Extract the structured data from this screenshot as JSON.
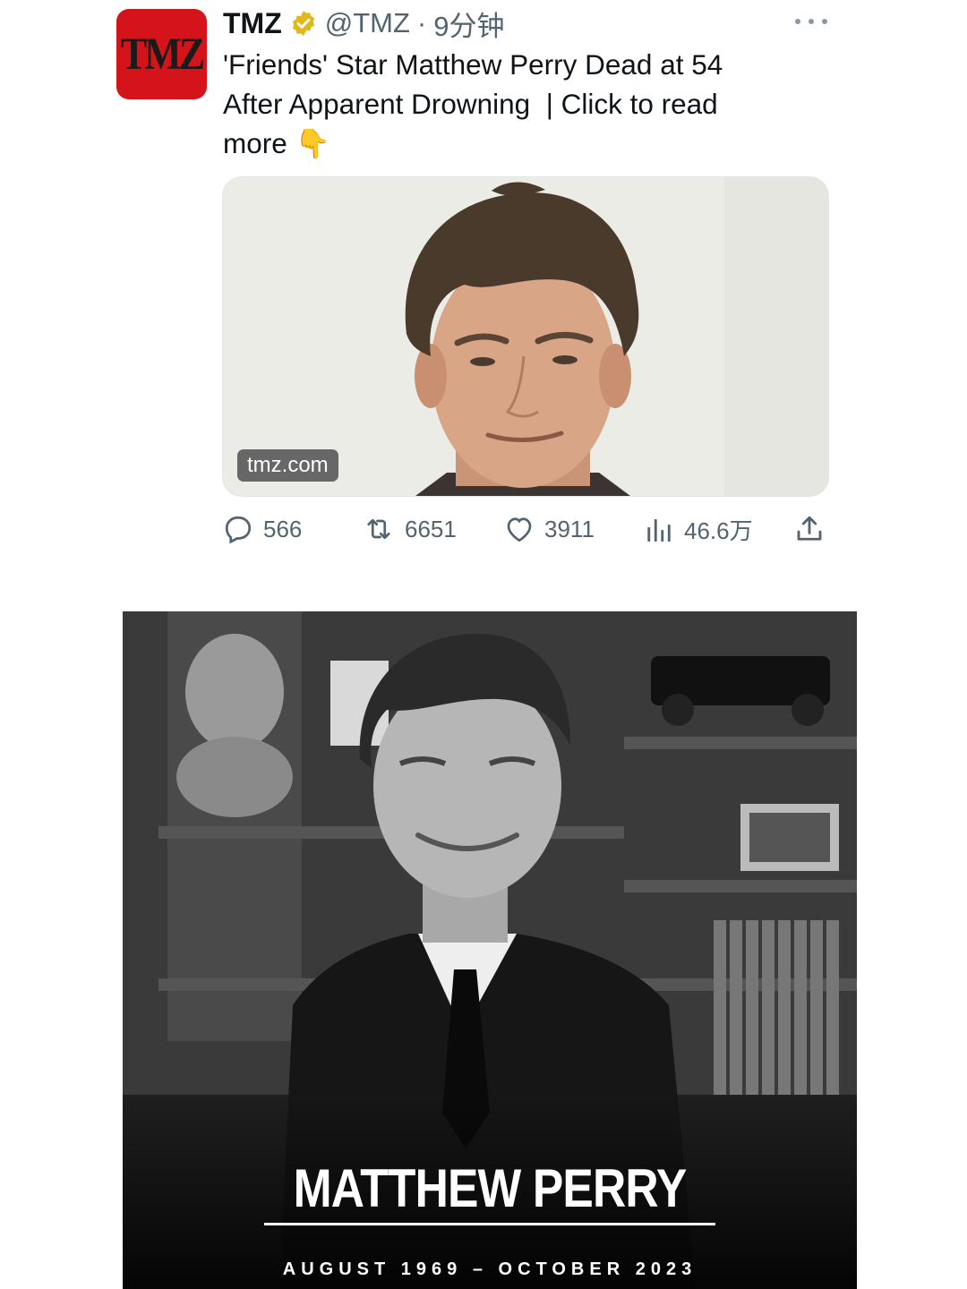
{
  "tweet": {
    "avatar_text": "TMZ",
    "author_name": "TMZ",
    "handle": "@TMZ",
    "separator": "·",
    "time": "9分钟",
    "text": "'Friends' Star Matthew Perry Dead at 54\nAfter Apparent Drowning  | Click to read\nmore ",
    "emoji": "👇",
    "card": {
      "domain": "tmz.com"
    },
    "stats": {
      "replies": "566",
      "retweets": "6651",
      "likes": "3911",
      "views": "46.6万"
    }
  },
  "memorial": {
    "name": "MATTHEW PERRY",
    "dates": "AUGUST 1969 – OCTOBER 2023"
  },
  "colors": {
    "brand_red": "#d4141a",
    "verified_gold": "#e2b719",
    "text_primary": "#0f1419",
    "text_secondary": "#536471"
  },
  "icons": [
    "verified-badge-icon",
    "more-icon",
    "reply-icon",
    "retweet-icon",
    "like-icon",
    "views-icon",
    "share-icon"
  ]
}
